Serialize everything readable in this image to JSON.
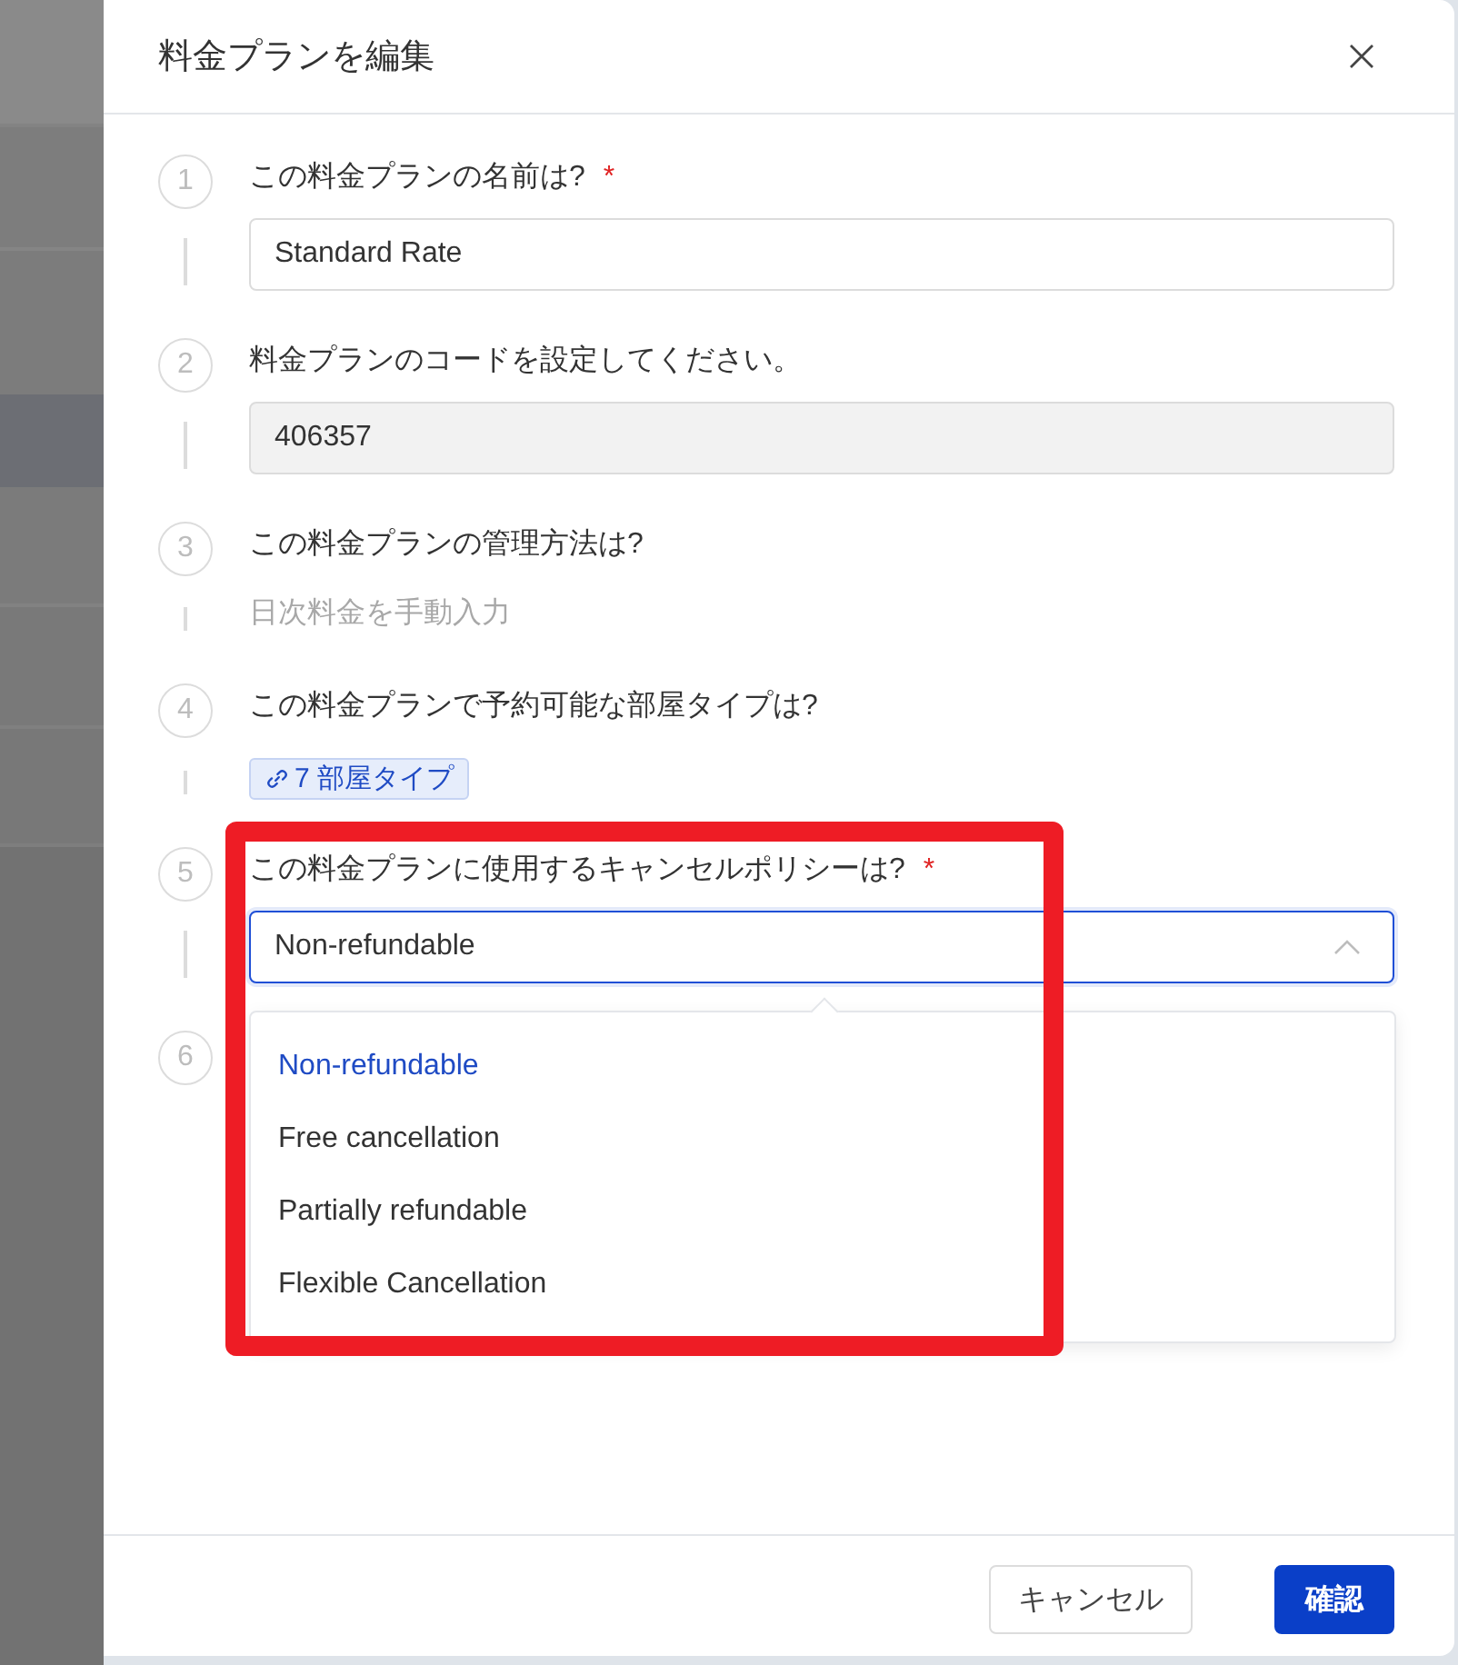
{
  "dialog": {
    "title": "料金プランを編集"
  },
  "steps": [
    {
      "number": "1",
      "label": "この料金プランの名前は?",
      "required_mark": "*",
      "kind": "input",
      "value": "Standard Rate",
      "disabled": false
    },
    {
      "number": "2",
      "label": "料金プランのコードを設定してください。",
      "kind": "input",
      "value": "406357",
      "disabled": true
    },
    {
      "number": "3",
      "label": "この料金プランの管理方法は?",
      "kind": "text",
      "value": "日次料金を手動入力"
    },
    {
      "number": "4",
      "label": "この料金プランで予約可能な部屋タイプは?",
      "kind": "tag",
      "value": "7 部屋タイプ"
    },
    {
      "number": "5",
      "label": "この料金プランに使用するキャンセルポリシーは?",
      "required_mark": "*",
      "kind": "select",
      "value": "Non-refundable",
      "expanded": true,
      "options": [
        {
          "label": "Non-refundable",
          "selected": true
        },
        {
          "label": "Free cancellation",
          "selected": false
        },
        {
          "label": "Partially refundable",
          "selected": false
        },
        {
          "label": "Flexible Cancellation",
          "selected": false
        }
      ]
    },
    {
      "number": "6"
    }
  ],
  "footer": {
    "buttons": [
      {
        "label": "キャンセル",
        "kind": "secondary"
      },
      {
        "label": "確認",
        "kind": "primary"
      }
    ]
  }
}
